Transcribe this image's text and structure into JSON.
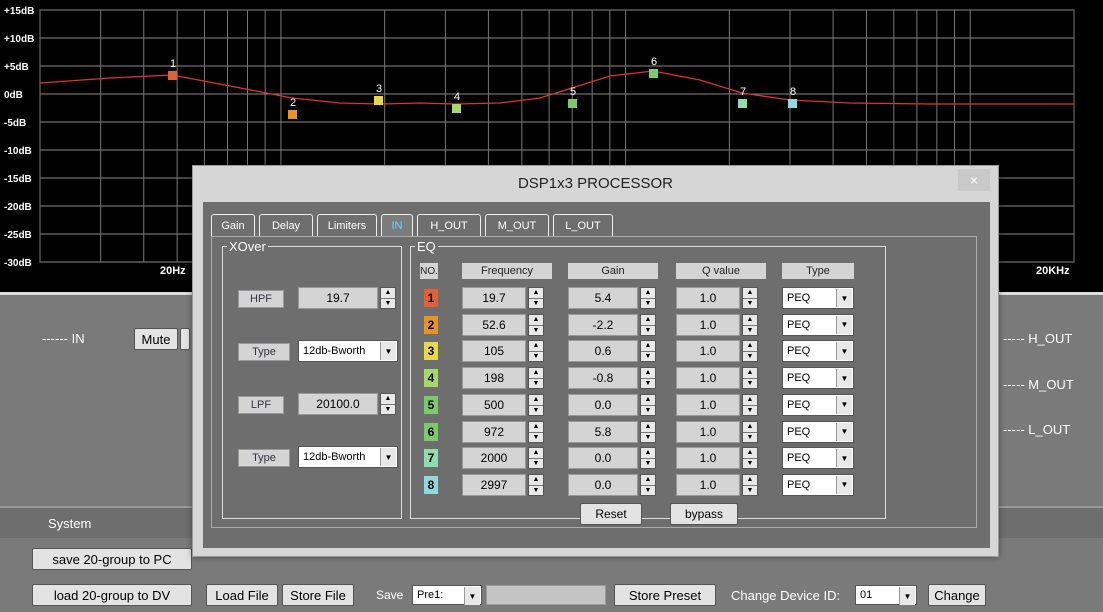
{
  "graph": {
    "y_labels": [
      "+15dB",
      "+10dB",
      "+5dB",
      "0dB",
      "-5dB",
      "-10dB",
      "-15dB",
      "-20dB",
      "-25dB",
      "-30dB"
    ],
    "x_labels": [
      "20Hz",
      "20KHz"
    ],
    "markers": [
      {
        "label": "1",
        "color": "#e0603a"
      },
      {
        "label": "2",
        "color": "#e8922a"
      },
      {
        "label": "3",
        "color": "#e8d84a"
      },
      {
        "label": "4",
        "color": "#a6d86a"
      },
      {
        "label": "5",
        "color": "#7cc86a"
      },
      {
        "label": "6",
        "color": "#7cc86a"
      },
      {
        "label": "7",
        "color": "#8fdcb0"
      },
      {
        "label": "8",
        "color": "#8fd8e0"
      }
    ]
  },
  "routing": {
    "in_label": "------  IN",
    "mute_label": "Mute",
    "out_labels": [
      "----- H_OUT",
      "----- M_OUT",
      "----- L_OUT"
    ]
  },
  "system": {
    "title": "System",
    "save_pc": "save 20-group to PC",
    "load_dv": "load 20-group to DV",
    "load_file": "Load File",
    "store_file": "Store File",
    "save_label": "Save",
    "preset_value": "Pre1:",
    "store_preset": "Store Preset",
    "change_id_label": "Change Device ID:",
    "device_id": "01",
    "change": "Change"
  },
  "dialog": {
    "title": "DSP1x3 PROCESSOR",
    "close": "×",
    "tabs": [
      "Gain",
      "Delay",
      "Limiters",
      "IN",
      "H_OUT",
      "M_OUT",
      "L_OUT"
    ],
    "active_tab": "IN",
    "xover": {
      "legend": "XOver",
      "hpf_label": "HPF",
      "hpf_value": "19.7",
      "type_label": "Type",
      "hpf_type": "12db-Bworth",
      "lpf_label": "LPF",
      "lpf_value": "20100.0",
      "lpf_type": "12db-Bworth"
    },
    "eq": {
      "legend": "EQ",
      "headers": [
        "NO.",
        "Frequency",
        "Gain",
        "Q value",
        "Type"
      ],
      "rows": [
        {
          "no": "1",
          "freq": "19.7",
          "gain": "5.4",
          "q": "1.0",
          "type": "PEQ",
          "color": "#e0603a"
        },
        {
          "no": "2",
          "freq": "52.6",
          "gain": "-2.2",
          "q": "1.0",
          "type": "PEQ",
          "color": "#e8922a"
        },
        {
          "no": "3",
          "freq": "105",
          "gain": "0.6",
          "q": "1.0",
          "type": "PEQ",
          "color": "#e8d84a"
        },
        {
          "no": "4",
          "freq": "198",
          "gain": "-0.8",
          "q": "1.0",
          "type": "PEQ",
          "color": "#a6d86a"
        },
        {
          "no": "5",
          "freq": "500",
          "gain": "0.0",
          "q": "1.0",
          "type": "PEQ",
          "color": "#7cc86a"
        },
        {
          "no": "6",
          "freq": "972",
          "gain": "5.8",
          "q": "1.0",
          "type": "PEQ",
          "color": "#7cc86a"
        },
        {
          "no": "7",
          "freq": "2000",
          "gain": "0.0",
          "q": "1.0",
          "type": "PEQ",
          "color": "#8fdcb0"
        },
        {
          "no": "8",
          "freq": "2997",
          "gain": "0.0",
          "q": "1.0",
          "type": "PEQ",
          "color": "#8fd8e0"
        }
      ],
      "reset": "Reset",
      "bypass": "bypass"
    }
  }
}
